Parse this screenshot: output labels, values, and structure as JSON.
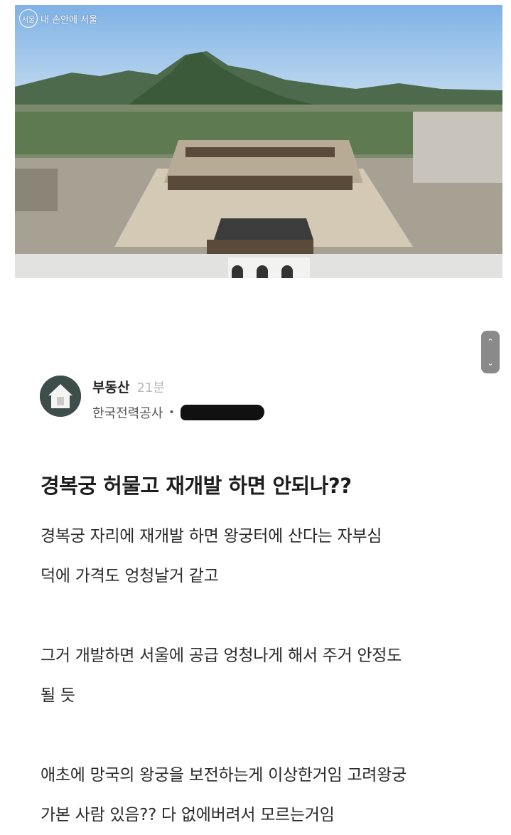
{
  "photo": {
    "watermark_text": "내 손안에 서울",
    "watermark_logo": "서울",
    "description_icon": "gyeongbokgung-aerial-photo"
  },
  "scroller": {
    "up_icon": "chevron-up-icon",
    "down_icon": "chevron-down-icon"
  },
  "author": {
    "name": "부동산",
    "time": "21분",
    "company": "한국전력공사",
    "separator": "•"
  },
  "post": {
    "title": "경복궁 허물고 재개발 하면 안되나??",
    "paragraphs": [
      [
        "경복궁 자리에 재개발 하면 왕궁터에 산다는 자부심",
        "덕에 가격도 엉청날거 같고"
      ],
      [
        "그거 개발하면 서울에 공급 엉청나게 해서 주거 안정도",
        "될 듯"
      ],
      [
        "애초에 망국의 왕궁을 보전하는게 이상한거임 고려왕궁",
        "가본 사람 있음?? 다 없에버려서 모르는거임"
      ]
    ]
  },
  "colors": {
    "accent": "#222222",
    "muted": "#b8b8b8",
    "scroller": "#8a8a8a"
  }
}
